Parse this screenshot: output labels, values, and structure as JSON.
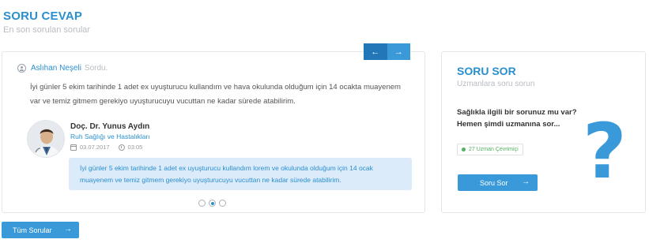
{
  "header": {
    "title": "SORU CEVAP",
    "subtitle": "En son sorulan sorular"
  },
  "carousel": {
    "prev_icon": "←",
    "next_icon": "→",
    "asker_name": "Aslıhan Neşeli",
    "asker_verb": "Sordu.",
    "question": "İyi günler 5 ekim tarihinde 1 adet ex uyuşturucu kullandım ve hava okulunda olduğum için 14 ocakta muayenem var ve temiz gitmem gerekiyo uyuşturucuyu vucuttan ne kadar sürede atabilirim.",
    "doctor": {
      "name": "Doç. Dr. Yunus Aydın",
      "department": "Ruh Sağlığı ve Hastalıkları",
      "date": "03.07.2017",
      "time": "03:05"
    },
    "answer": "İyi günler 5 ekim tarihinde 1 adet ex uyuşturucu kullandım lorem  ve okulunda olduğum için 14 ocak muayenem ve temiz gitmem gerekiyo uyuşturucuyu vucuttan ne kadar sürede atabilirim.",
    "pages": 3,
    "active_page": 2
  },
  "all_button": {
    "label": "Tüm Sorular",
    "icon": "→"
  },
  "ask": {
    "title": "SORU SOR",
    "subtitle": "Uzmanlara soru sorun",
    "text": "Sağlıkla ilgili bir sorunuz mu var? Hemen şimdi uzmanına sor...",
    "online": "27 Uzman Çevrimiçi",
    "button_label": "Soru Sor",
    "button_icon": "→",
    "question_mark": "?"
  },
  "colors": {
    "accent": "#3a9ad9",
    "accent_dark": "#2277b8",
    "answer_bg": "#dcebfa",
    "online": "#52b05e"
  }
}
